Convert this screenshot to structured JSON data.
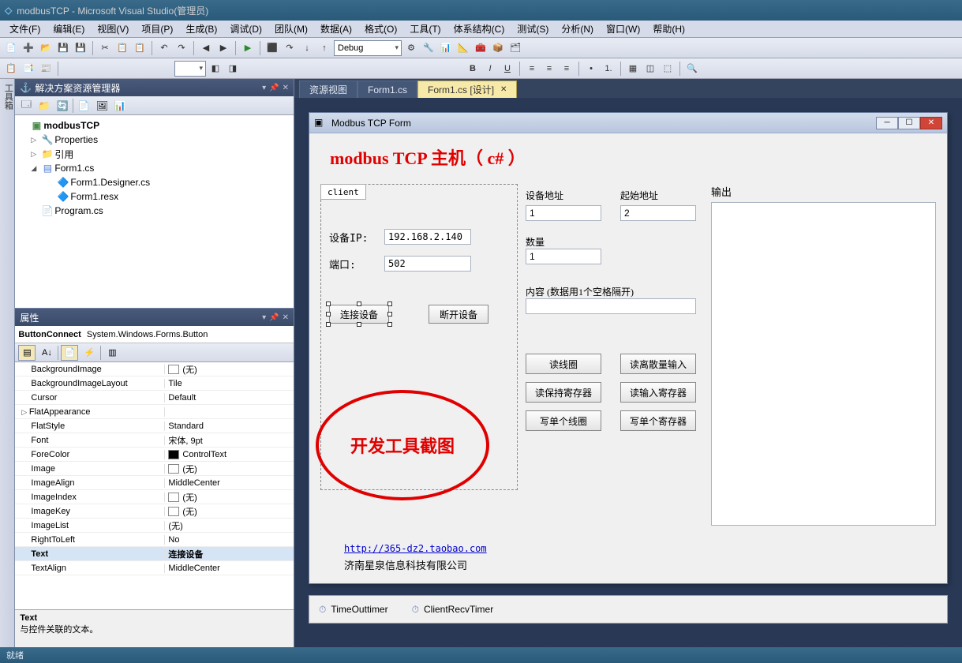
{
  "window": {
    "title": "modbusTCP - Microsoft Visual Studio(管理员)"
  },
  "menu": [
    "文件(F)",
    "编辑(E)",
    "视图(V)",
    "项目(P)",
    "生成(B)",
    "调试(D)",
    "团队(M)",
    "数据(A)",
    "格式(O)",
    "工具(T)",
    "体系结构(C)",
    "测试(S)",
    "分析(N)",
    "窗口(W)",
    "帮助(H)"
  ],
  "toolbar": {
    "config": "Debug"
  },
  "leftDock": {
    "toolbox": "工具箱"
  },
  "solutionExplorer": {
    "title": "解决方案资源管理器",
    "project": "modbusTCP",
    "nodes": {
      "properties": "Properties",
      "references": "引用",
      "form1": "Form1.cs",
      "form1designer": "Form1.Designer.cs",
      "form1resx": "Form1.resx",
      "program": "Program.cs"
    }
  },
  "propsPanel": {
    "title": "属性",
    "selected": "ButtonConnect",
    "selectedType": "System.Windows.Forms.Button",
    "rows": [
      {
        "name": "BackgroundImage",
        "value": "(无)",
        "swatch": "#ffffff"
      },
      {
        "name": "BackgroundImageLayout",
        "value": "Tile"
      },
      {
        "name": "Cursor",
        "value": "Default"
      },
      {
        "name": "FlatAppearance",
        "value": ""
      },
      {
        "name": "FlatStyle",
        "value": "Standard"
      },
      {
        "name": "Font",
        "value": "宋体, 9pt"
      },
      {
        "name": "ForeColor",
        "value": "ControlText",
        "swatch": "#000000"
      },
      {
        "name": "Image",
        "value": "(无)",
        "swatch": "#ffffff"
      },
      {
        "name": "ImageAlign",
        "value": "MiddleCenter"
      },
      {
        "name": "ImageIndex",
        "value": "(无)",
        "swatch": "#ffffff"
      },
      {
        "name": "ImageKey",
        "value": "(无)",
        "swatch": "#ffffff"
      },
      {
        "name": "ImageList",
        "value": "(无)"
      },
      {
        "name": "RightToLeft",
        "value": "No"
      },
      {
        "name": "Text",
        "value": "连接设备",
        "selected": true
      },
      {
        "name": "TextAlign",
        "value": "MiddleCenter"
      }
    ],
    "desc": {
      "name": "Text",
      "text": "与控件关联的文本。"
    }
  },
  "tabs": [
    {
      "label": "资源视图",
      "active": false
    },
    {
      "label": "Form1.cs",
      "active": false
    },
    {
      "label": "Form1.cs [设计]",
      "active": true
    }
  ],
  "form": {
    "title": "Modbus TCP Form",
    "heading": "modbus TCP 主机（ c# ）",
    "clientTab": "client",
    "labels": {
      "ip": "设备IP:",
      "port": "端口:",
      "connect": "连接设备",
      "disconnect": "断开设备",
      "devAddr": "设备地址",
      "startAddr": "起始地址",
      "qty": "数量",
      "content": "内容 (数据用1个空格隔开)",
      "output": "输出"
    },
    "values": {
      "ip": "192.168.2.140",
      "port": "502",
      "devAddr": "1",
      "startAddr": "2",
      "qty": "1",
      "content": ""
    },
    "buttons": {
      "readCoils": "读线圈",
      "readDiscrete": "读离散量输入",
      "readHolding": "读保持寄存器",
      "readInput": "读输入寄存器",
      "writeCoil": "写单个线圈",
      "writeReg": "写单个寄存器"
    },
    "link": "http://365-dz2.taobao.com",
    "company": "济南星泉信息科技有限公司",
    "annotation": "开发工具截图"
  },
  "tray": {
    "timer1": "TimeOuttimer",
    "timer2": "ClientRecvTimer"
  },
  "status": {
    "ready": "就绪"
  }
}
